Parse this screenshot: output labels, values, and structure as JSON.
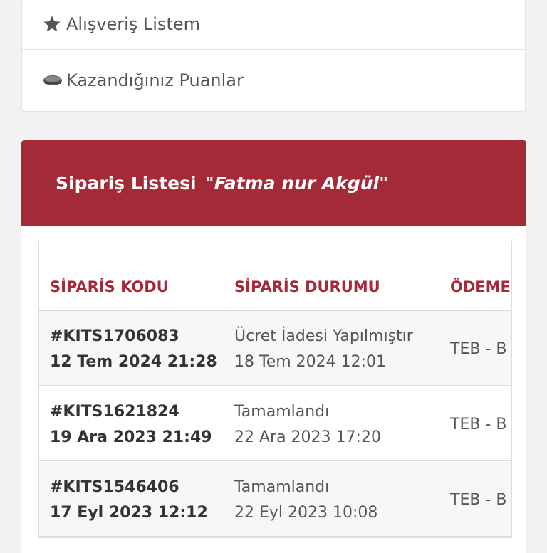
{
  "menu": {
    "items": [
      {
        "label": "Alışveriş Listem",
        "icon": "star-icon"
      },
      {
        "label": "Kazandığınız Puanlar",
        "icon": "coins-icon"
      }
    ]
  },
  "orders_panel": {
    "title": "Sipariş Listesi",
    "customer_name": "\"Fatma nur Akgül\"",
    "accent_color": "#a52a38"
  },
  "table": {
    "headers": [
      "SİPARİS KODU",
      "SİPARİS DURUMU",
      "ÖDEME"
    ],
    "rows": [
      {
        "code": "#KITS1706083",
        "order_date": "12 Tem 2024 21:28",
        "status": "Ücret İadesi Yapılmıştır",
        "status_date": "18 Tem 2024 12:01",
        "payment": "TEB - B"
      },
      {
        "code": "#KITS1621824",
        "order_date": "19 Ara 2023 21:49",
        "status": "Tamamlandı",
        "status_date": "22 Ara 2023 17:20",
        "payment": "TEB - B"
      },
      {
        "code": "#KITS1546406",
        "order_date": "17 Eyl 2023 12:12",
        "status": "Tamamlandı",
        "status_date": "22 Eyl 2023 10:08",
        "payment": "TEB - B"
      }
    ]
  }
}
